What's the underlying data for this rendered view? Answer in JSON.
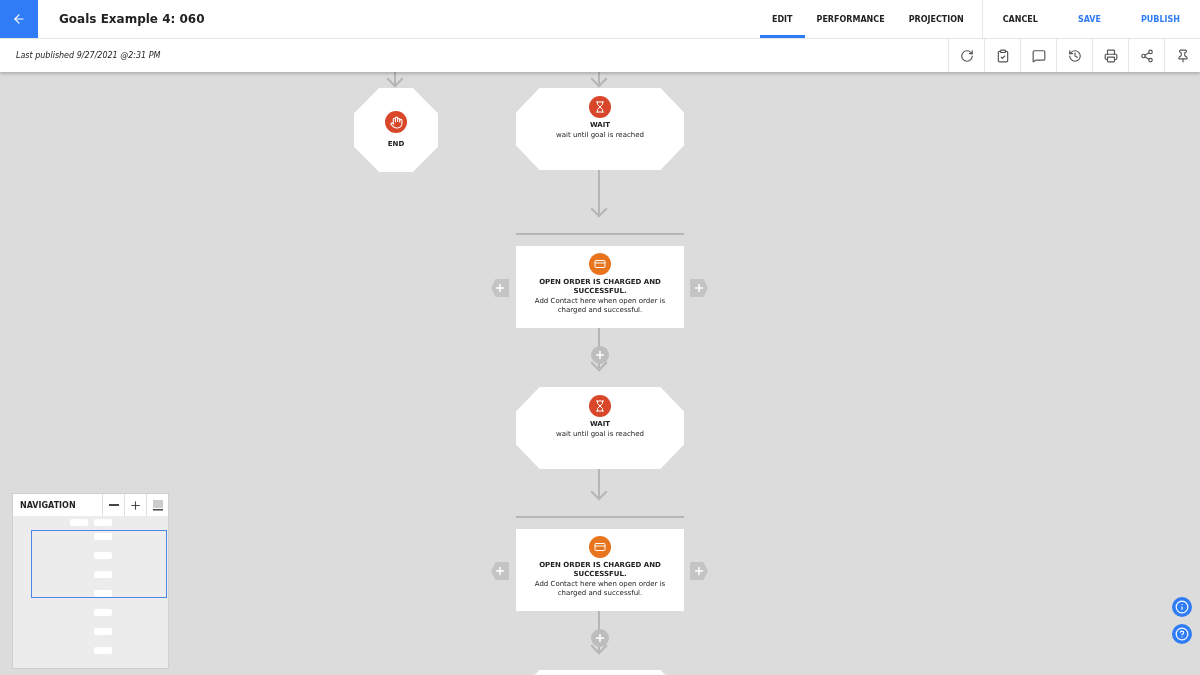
{
  "header": {
    "title": "Goals Example 4: 060",
    "tabs": [
      {
        "label": "EDIT",
        "selected": true
      },
      {
        "label": "PERFORMANCE",
        "selected": false
      },
      {
        "label": "PROJECTION",
        "selected": false
      }
    ],
    "actions": [
      {
        "label": "CANCEL",
        "kind": "plain"
      },
      {
        "label": "SAVE",
        "kind": "accent"
      },
      {
        "label": "PUBLISH",
        "kind": "accent"
      }
    ]
  },
  "subbar": {
    "last_published": "Last published 9/27/2021 @2:31 PM"
  },
  "nodes": [
    {
      "kind": "end",
      "title": "END"
    },
    {
      "kind": "wait",
      "title": "WAIT",
      "description": "wait until goal is reached"
    },
    {
      "kind": "goal",
      "title": "OPEN ORDER IS CHARGED AND SUCCESSFUL.",
      "description": "Add Contact here when open order is charged and successful."
    },
    {
      "kind": "wait",
      "title": "WAIT",
      "description": "wait until goal is reached"
    },
    {
      "kind": "goal",
      "title": "OPEN ORDER IS CHARGED AND SUCCESSFUL.",
      "description": "Add Contact here when open order is charged and successful."
    },
    {
      "kind": "wait"
    }
  ],
  "navigation": {
    "title": "NAVIGATION"
  }
}
